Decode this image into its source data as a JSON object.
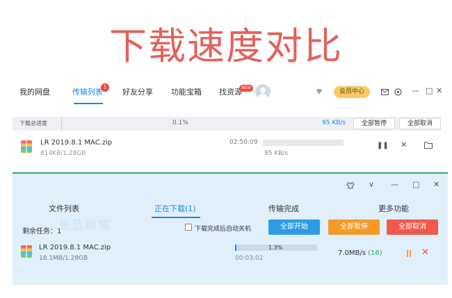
{
  "headline": "下载速度对比",
  "baidu": {
    "tabs": [
      "我的网盘",
      "传输列表",
      "好友分享",
      "功能宝箱",
      "找资源"
    ],
    "active_tab": "传输列表",
    "badge_count": "1",
    "new_badge": "NEW",
    "vip_label": "会员中心",
    "progress_label": "下载总进度",
    "progress_percent": "0.1%",
    "progress_fraction": 0.001,
    "progress_speed": "95 KB/s",
    "pause_all": "全部暂停",
    "cancel_all": "全部取消",
    "file": {
      "name": "LR 2019.8.1 MAC.zip",
      "size": "814KB/1.28GB",
      "time_left": "02:50:09",
      "speed": "95 KB/s"
    },
    "icons": [
      "diamond-icon",
      "mail-icon",
      "settings-icon",
      "minimize-icon",
      "maximize-icon",
      "close-icon",
      "pause-icon",
      "cancel-icon",
      "folder-icon"
    ]
  },
  "other_client": {
    "tabs": [
      "文件列表",
      "正在下载(1)",
      "传输完成",
      "更多功能"
    ],
    "active_tab": "正在下载(1)",
    "watermark": "长蓝狮猫",
    "remaining": "剩余任务：1",
    "auto_shutdown": "下载完成后自动关机",
    "buttons": {
      "start_all": "全部开始",
      "pause_all": "全部暂停",
      "cancel_all": "全部取消"
    },
    "colors": {
      "start_all": "#2d9be6",
      "pause_all": "#f39a2a",
      "cancel_all": "#ef5a4c"
    },
    "file": {
      "name": "LR 2019.8.1 MAC.zip",
      "size": "18.1MB/1.28GB",
      "percent": "1.3%",
      "progress_fraction": 0.013,
      "time_left": "00:03:02",
      "speed": "7.0MB/s",
      "connections": "(16)"
    }
  }
}
